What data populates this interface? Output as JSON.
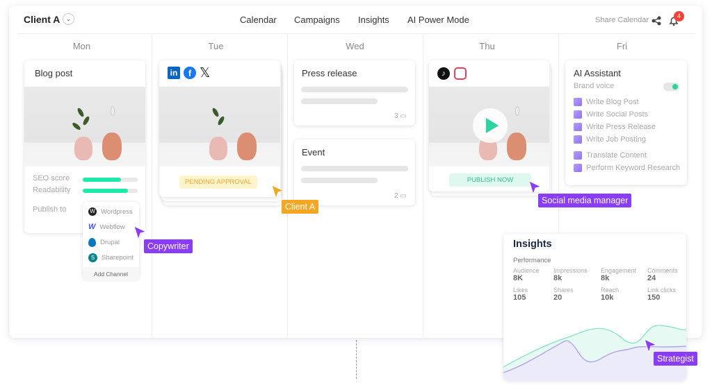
{
  "header": {
    "client": "Client A",
    "nav": [
      "Calendar",
      "Campaigns",
      "Insights",
      "AI Power Mode"
    ],
    "share": "Share Calendar",
    "notifications": "4"
  },
  "days": [
    "Mon",
    "Tue",
    "Wed",
    "Thu",
    "Fri"
  ],
  "mon": {
    "title": "Blog post",
    "seo_label": "SEO score",
    "seo_value": 0.7,
    "read_label": "Readability",
    "read_value": 0.82,
    "publish_label": "Publish to",
    "channels": [
      {
        "label": "Wordpress",
        "icon": "wordpress-icon"
      },
      {
        "label": "Webflow",
        "icon": "webflow-icon"
      },
      {
        "label": "Drupal",
        "icon": "drupal-icon"
      },
      {
        "label": "Sharepoint",
        "icon": "sharepoint-icon"
      }
    ],
    "add_channel": "Add Channel"
  },
  "tue": {
    "socials": [
      "linkedin-icon",
      "facebook-icon",
      "x-icon"
    ],
    "status": "PENDING APPROVAL"
  },
  "wed": {
    "cards": [
      {
        "title": "Press release",
        "comments": "3"
      },
      {
        "title": "Event",
        "comments": "2"
      }
    ]
  },
  "thu": {
    "socials": [
      "tiktok-icon",
      "instagram-icon"
    ],
    "action": "PUBLISH NOW"
  },
  "fri": {
    "title": "AI Assistant",
    "brand_voice": "Brand voice",
    "brand_voice_on": true,
    "items": [
      "Write Blog Post",
      "Write Social Posts",
      "Write Press Release",
      "Write Job Posting",
      "Translate Content",
      "Perform Keyword Research"
    ]
  },
  "insights": {
    "title": "Insights",
    "section": "Performance",
    "metrics": [
      {
        "label": "Audience",
        "value": "8K"
      },
      {
        "label": "Impressions",
        "value": "8k"
      },
      {
        "label": "Engagement",
        "value": "8k"
      },
      {
        "label": "Comments",
        "value": "24"
      },
      {
        "label": "Likes",
        "value": "105"
      },
      {
        "label": "Shares",
        "value": "20"
      },
      {
        "label": "Reach",
        "value": "10k"
      },
      {
        "label": "Link clicks",
        "value": "150"
      }
    ]
  },
  "cursors": [
    {
      "label": "Copywriter",
      "color": "#8b3cf7"
    },
    {
      "label": "Client A",
      "color": "#f5a623"
    },
    {
      "label": "Social media manager",
      "color": "#8b3cf7"
    },
    {
      "label": "Strategist",
      "color": "#8b3cf7"
    }
  ]
}
